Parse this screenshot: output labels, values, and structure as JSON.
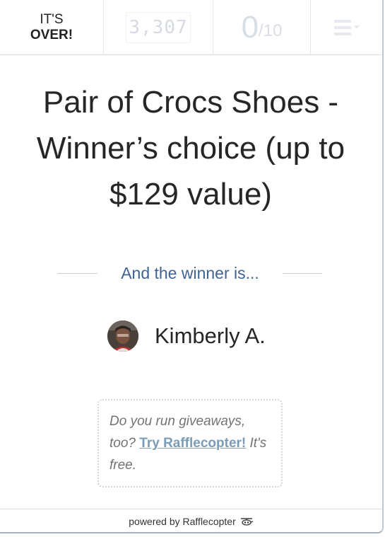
{
  "topbar": {
    "status_line1": "IT'S",
    "status_line2": "OVER!",
    "entries_count": "3,307",
    "score": "0",
    "score_total": "/10",
    "menu_icon": "hamburger-menu-icon"
  },
  "main": {
    "title": "Pair of Crocs Shoes - Winner’s choice (up to $129 value)",
    "winner_heading": "And the winner is...",
    "winner_name": "Kimberly A."
  },
  "promo": {
    "text_before": "Do you run giveaways, too? ",
    "link_label": "Try Rafflecopter!",
    "text_after": " It's free."
  },
  "footer": {
    "label": "powered by Rafflecopter",
    "logo_icon": "rafflecopter-logo-icon"
  },
  "colors": {
    "heading_blue": "#3f6392",
    "link_blue": "#7b9cb8",
    "text_dark": "#262626"
  }
}
